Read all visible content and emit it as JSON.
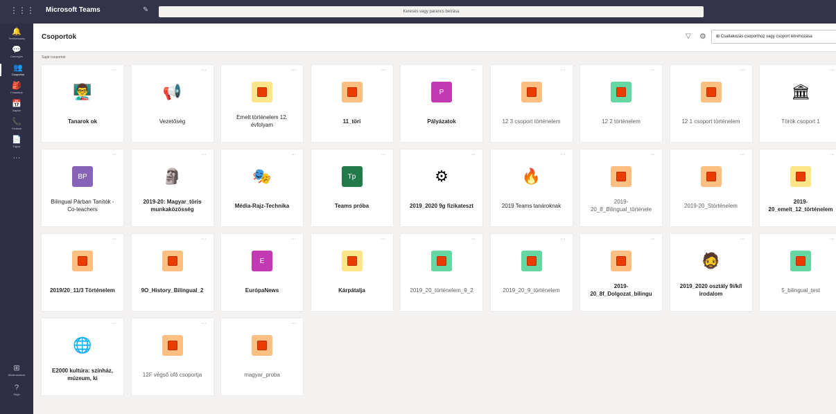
{
  "titlebar": {
    "app_name": "Microsoft Teams",
    "search_placeholder": "Keresés vagy parancs beírása"
  },
  "rail": [
    {
      "label": "Tevékenység",
      "icon": "bell-icon"
    },
    {
      "label": "Csevegés",
      "icon": "chat-icon"
    },
    {
      "label": "Csoportok",
      "icon": "teams-icon",
      "active": true
    },
    {
      "label": "Feladatok",
      "icon": "assignments-icon"
    },
    {
      "label": "Naptár",
      "icon": "calendar-icon"
    },
    {
      "label": "Hívások",
      "icon": "phone-icon"
    },
    {
      "label": "Fájlok",
      "icon": "files-icon"
    },
    {
      "label": "...",
      "icon": "more-icon"
    }
  ],
  "rail_bottom": [
    {
      "label": "Alkalmazások",
      "icon": "apps-icon"
    },
    {
      "label": "Súgó",
      "icon": "help-icon"
    }
  ],
  "header": {
    "title": "Csoportok",
    "join_label": "Csatlakozás csoporthoz vagy csoport létrehozása"
  },
  "section_label": "Saját csoportok",
  "colors": {
    "titlebar": "#33344a",
    "rail": "#2e2f45",
    "office_red": "#eb3c00"
  },
  "teams": [
    {
      "name": "Tanarok ok",
      "style": "bold",
      "avatar": {
        "type": "pic",
        "icon": "teacher-cartoon-icon",
        "glyph": "👨‍🏫"
      }
    },
    {
      "name": "Vezetőség",
      "style": "normal",
      "avatar": {
        "type": "pic",
        "icon": "megaphone-cartoon-icon",
        "glyph": "📢"
      }
    },
    {
      "name": "Emelt történelem 12. évfolyam",
      "style": "normal",
      "avatar": {
        "type": "office",
        "bg": "#fde58a"
      }
    },
    {
      "name": "11_töri",
      "style": "bold",
      "avatar": {
        "type": "office",
        "bg": "#fbbf82"
      }
    },
    {
      "name": "Pályázatok",
      "style": "bold",
      "avatar": {
        "type": "letter",
        "bg": "#c239b3",
        "text": "P"
      }
    },
    {
      "name": "12 3 csoport történelem",
      "style": "light",
      "avatar": {
        "type": "office",
        "bg": "#fbbf82"
      }
    },
    {
      "name": "12 2 történelem",
      "style": "light",
      "avatar": {
        "type": "office",
        "bg": "#64d7a2"
      }
    },
    {
      "name": "12 1 csoport történelem",
      "style": "light",
      "avatar": {
        "type": "office",
        "bg": "#fbbf82"
      }
    },
    {
      "name": "Török csoport 1",
      "style": "light",
      "avatar": {
        "type": "pic",
        "icon": "column-icon",
        "glyph": "🏛"
      }
    },
    {
      "name": "Bilingual Párban Tanítók - Co-teachers",
      "style": "normal",
      "avatar": {
        "type": "letter",
        "bg": "#8764b8",
        "text": "BP"
      }
    },
    {
      "name": "2019-20: Magyar_töris munkaközösség",
      "style": "bold",
      "avatar": {
        "type": "pic",
        "icon": "statue-photo-icon",
        "glyph": "🗿"
      }
    },
    {
      "name": "Média-Rajz-Technika",
      "style": "bold",
      "avatar": {
        "type": "pic",
        "icon": "theater-masks-icon",
        "glyph": "🎭"
      }
    },
    {
      "name": "Teams próba",
      "style": "bold",
      "avatar": {
        "type": "letter",
        "bg": "#237b4b",
        "text": "Tp"
      }
    },
    {
      "name": "2019_2020 9g fizikateszt",
      "style": "bold",
      "avatar": {
        "type": "pic",
        "icon": "gears-icon",
        "glyph": "⚙"
      }
    },
    {
      "name": "2019 Teams tanároknak",
      "style": "normal",
      "avatar": {
        "type": "pic",
        "icon": "campfire-icon",
        "glyph": "🔥"
      }
    },
    {
      "name": "2019-20_8_Bilingual_történele",
      "style": "light",
      "avatar": {
        "type": "office",
        "bg": "#fbbf82"
      }
    },
    {
      "name": "2019-20_Stórténelem",
      "style": "light",
      "avatar": {
        "type": "office",
        "bg": "#fbbf82"
      }
    },
    {
      "name": "2019-20_emelt_12_történelem",
      "style": "bold",
      "avatar": {
        "type": "office",
        "bg": "#fde58a"
      }
    },
    {
      "name": "2019/20_11/3 Történelem",
      "style": "bold",
      "avatar": {
        "type": "office",
        "bg": "#fbbf82"
      }
    },
    {
      "name": "9O_History_Bilingual_2",
      "style": "bold",
      "avatar": {
        "type": "office",
        "bg": "#fbbf82"
      }
    },
    {
      "name": "EurópaNews",
      "style": "bold",
      "avatar": {
        "type": "letter",
        "bg": "#c239b3",
        "text": "E"
      }
    },
    {
      "name": "Kárpátalja",
      "style": "bold",
      "avatar": {
        "type": "office",
        "bg": "#fde58a"
      }
    },
    {
      "name": "2019_20_történelem_9_2",
      "style": "light",
      "avatar": {
        "type": "office",
        "bg": "#64d7a2"
      }
    },
    {
      "name": "2019_20_9_történelem",
      "style": "light",
      "avatar": {
        "type": "office",
        "bg": "#64d7a2"
      }
    },
    {
      "name": "2019-20_8f_Dolgozat_bilingu",
      "style": "bold",
      "avatar": {
        "type": "office",
        "bg": "#fbbf82"
      }
    },
    {
      "name": "2019_2020 osztály 9i/k/l irodalom",
      "style": "bold",
      "avatar": {
        "type": "pic",
        "icon": "portrait-cartoon-icon",
        "glyph": "🧔"
      }
    },
    {
      "name": "5_bilingual_test",
      "style": "light",
      "avatar": {
        "type": "office",
        "bg": "#64d7a2"
      }
    },
    {
      "name": "E2000 kultúra: színház, múzeum, ki",
      "style": "bold",
      "avatar": {
        "type": "pic",
        "icon": "europa-logo-icon",
        "glyph": "🌐"
      }
    },
    {
      "name": "12F végső ofő csoportja",
      "style": "light",
      "avatar": {
        "type": "office",
        "bg": "#fbbf82"
      }
    },
    {
      "name": "magyar_proba",
      "style": "light",
      "avatar": {
        "type": "office",
        "bg": "#fbbf82"
      }
    }
  ]
}
